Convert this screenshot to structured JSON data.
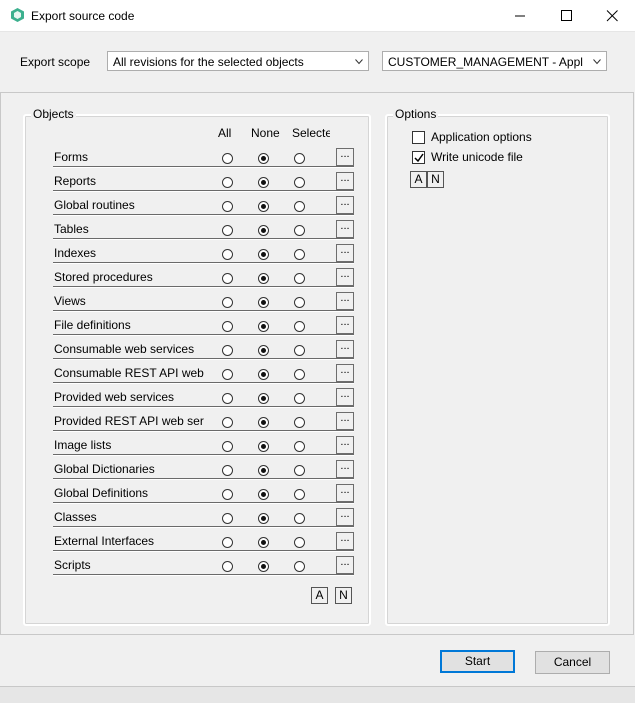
{
  "window": {
    "title": "Export source code",
    "icon": "app-hexagon-icon",
    "controls": [
      "minimize-icon",
      "maximize-icon",
      "close-icon"
    ]
  },
  "scope": {
    "label": "Export scope",
    "selected": "All revisions for the selected objects",
    "object_selected": "CUSTOMER_MANAGEMENT - Appl"
  },
  "objects": {
    "title": "Objects",
    "columns": [
      "All",
      "None",
      "Selecte"
    ],
    "rows": [
      {
        "label": "Forms",
        "selected": "None"
      },
      {
        "label": "Reports",
        "selected": "None"
      },
      {
        "label": "Global routines",
        "selected": "None"
      },
      {
        "label": "Tables",
        "selected": "None"
      },
      {
        "label": "Indexes",
        "selected": "None"
      },
      {
        "label": "Stored procedures",
        "selected": "None"
      },
      {
        "label": "Views",
        "selected": "None"
      },
      {
        "label": "File definitions",
        "selected": "None"
      },
      {
        "label": "Consumable web services",
        "selected": "None"
      },
      {
        "label": "Consumable REST API web",
        "selected": "None"
      },
      {
        "label": "Provided web services",
        "selected": "None"
      },
      {
        "label": "Provided REST API web ser",
        "selected": "None"
      },
      {
        "label": "Image lists",
        "selected": "None"
      },
      {
        "label": "Global Dictionaries",
        "selected": "None"
      },
      {
        "label": "Global Definitions",
        "selected": "None"
      },
      {
        "label": "Classes",
        "selected": "None"
      },
      {
        "label": "External Interfaces",
        "selected": "None"
      },
      {
        "label": "Scripts",
        "selected": "None"
      }
    ],
    "dots_label": "...",
    "all_button": "A",
    "none_button": "N"
  },
  "options": {
    "title": "Options",
    "items": [
      {
        "label": "Application options",
        "checked": false
      },
      {
        "label": "Write unicode file",
        "checked": true
      }
    ],
    "all_button": "A",
    "none_button": "N"
  },
  "actions": {
    "start": "Start",
    "cancel": "Cancel"
  }
}
